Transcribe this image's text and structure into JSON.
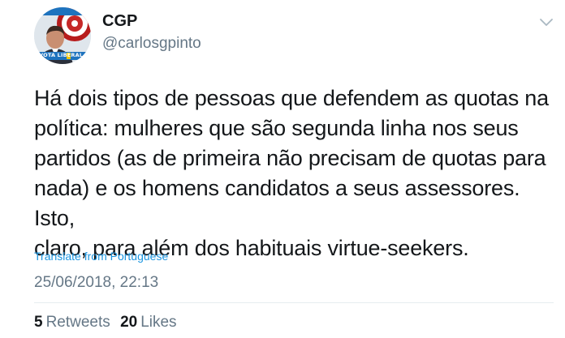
{
  "author": {
    "name": "CGP",
    "handle": "@carlosgpinto",
    "avatar_caption": "VOTA LIBERAL"
  },
  "tweet": {
    "text": "Há dois tipos de pessoas que defendem as quotas na\npolítica: mulheres que são segunda linha nos seus\npartidos (as de primeira não precisam de quotas para\nnada) e os homens candidatos a seus assessores. Isto,\nclaro, para além dos habituais virtue-seekers.",
    "translate_label": "Translate from Portuguese",
    "timestamp": "25/06/2018, 22:13"
  },
  "stats": {
    "retweets_count": "5",
    "retweets_label": "Retweets",
    "likes_count": "20",
    "likes_label": "Likes"
  },
  "icons": {
    "menu": "chevron-down-icon"
  },
  "colors": {
    "text": "#14171a",
    "secondary": "#657786",
    "link": "#1b95e0",
    "divider": "#e6ecf0"
  }
}
